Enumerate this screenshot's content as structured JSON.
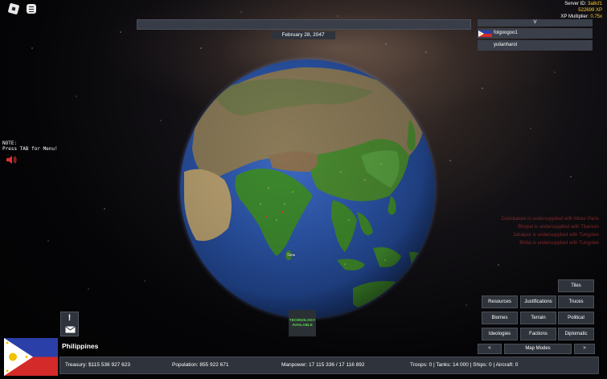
{
  "server": {
    "id_label": "Server ID:",
    "id_value": "3a8cf1",
    "xp_value": "522699 XP",
    "multiplier_label": "XP Multiplier:",
    "multiplier_value": "0.75x"
  },
  "date": "February 28, 2047",
  "player_list": {
    "toggle": "V",
    "players": [
      "folgoogoo1",
      "yulianharol"
    ]
  },
  "note": {
    "line1": "NOTE:",
    "line2": "Press TAB for Menu!"
  },
  "globe_label": "Sea",
  "messages": [
    "Coimbatore is undersupplied with Motor Parts",
    "Bhopal is undersupplied with Titanium",
    "Jabalpur is undersupplied with Tungsten",
    "Bhilai is undersupplied with Tungsten"
  ],
  "tech": {
    "line1": "TECHNOLOGY",
    "line2": "AVAILABLE"
  },
  "alert": {
    "symbol": "!"
  },
  "country": {
    "name": "Philippines"
  },
  "stats": {
    "treasury": "Treasury:  $115 536 927 623",
    "population": "Population:  855 922 671",
    "manpower": "Manpower:  17 115 336  /  17 116 892",
    "military": "Troops: 0  |  Tanks: 14 000  |  Ships: 0  |  Aircraft: 0"
  },
  "map_modes": {
    "tiles": "Tiles",
    "resources": "Resources",
    "justifications": "Justifications",
    "truces": "Truces",
    "biomes": "Biomes",
    "terrain": "Terrain",
    "political": "Political",
    "ideologies": "Ideologies",
    "factions": "Factions",
    "diplomatic": "Diplomatic",
    "prev": "<",
    "label": "Map Modes",
    "next": ">"
  },
  "colors": {
    "panel": "#2f343c",
    "gold": "#ffcf30",
    "tech_green": "#58d84e",
    "warning": "#7a2a2a"
  }
}
